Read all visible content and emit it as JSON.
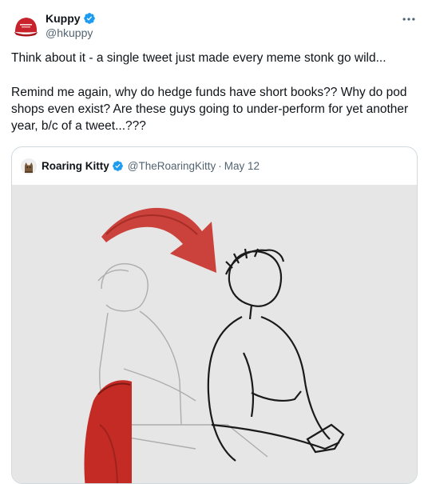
{
  "author": {
    "name": "Kuppy",
    "handle": "@hkuppy",
    "verified": true
  },
  "tweet": {
    "paragraph_1": "Think about it - a single tweet just made every meme stonk go wild...",
    "paragraph_2": "Remind me again, why do hedge funds have short books?? Why do pod shops even exist? Are these guys going to under-perform for yet another year, b/c of a tweet...???"
  },
  "quoted": {
    "name": "Roaring Kitty",
    "handle": "@TheRoaringKitty",
    "separator": "·",
    "date": "May 12",
    "verified": true
  },
  "icons": {
    "more": "more-horizontal-icon",
    "verified": "verified-badge-icon"
  },
  "colors": {
    "verified_blue": "#1d9bf0",
    "text_primary": "#0f1419",
    "text_secondary": "#536471",
    "border": "#cfd9de",
    "arrow_red": "#c8342c",
    "cap_red": "#c8232c"
  }
}
